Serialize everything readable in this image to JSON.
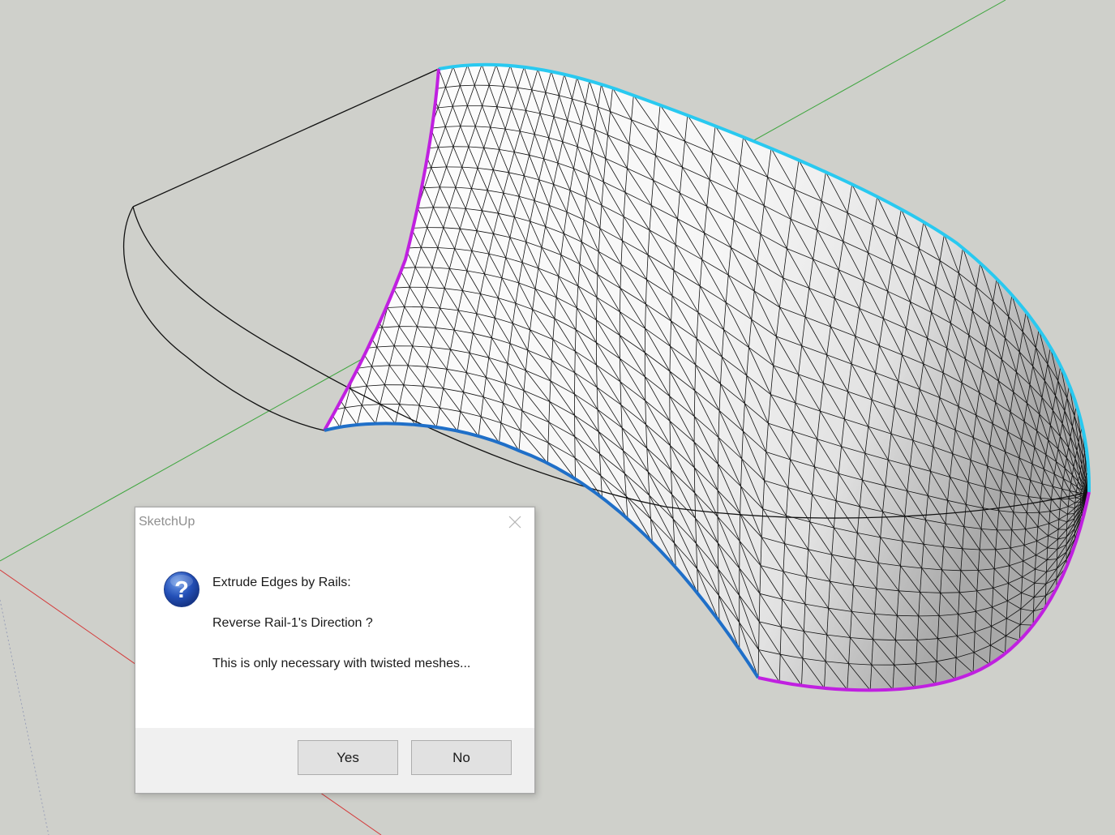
{
  "dialog": {
    "title": "SketchUp",
    "icon": "question-icon",
    "close_icon": "close-icon",
    "line1": "Extrude Edges by Rails:",
    "line2": "Reverse Rail-1's Direction ?",
    "line3": "This is only necessary with twisted meshes...",
    "yes_label": "Yes",
    "no_label": "No"
  },
  "colors": {
    "background": "#cfd0cb",
    "axis_green": "#3fa63f",
    "axis_red": "#d43a3a",
    "rail_cyan": "#29c9f0",
    "rail_magenta": "#c020e0",
    "rail_blue": "#1f6fc8",
    "mesh_edge": "#111111"
  }
}
